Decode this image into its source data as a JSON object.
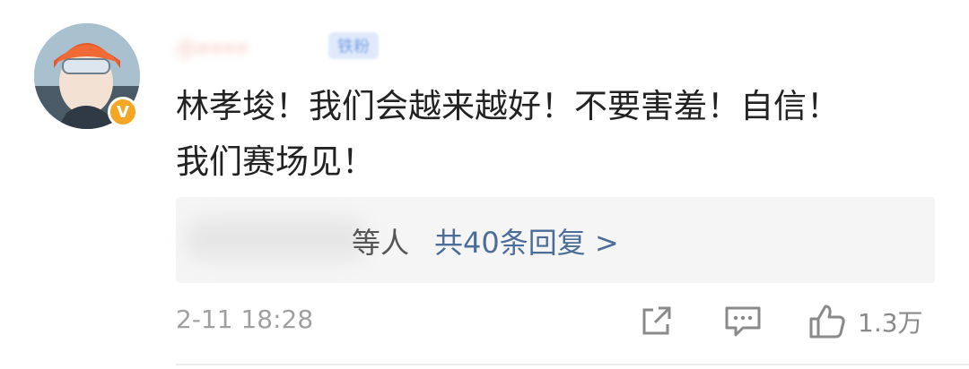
{
  "comment": {
    "author": {
      "name": "小••••",
      "fan_badge": "铁粉",
      "verified_badge": "V"
    },
    "text_line1": "林孝埈！我们会越来越好！不要害羞！自信！",
    "text_line2": "我们赛场见！",
    "replies": {
      "prefix": "等人",
      "link_text": "共40条回复 >"
    },
    "time": "2-11 18:28",
    "actions": {
      "likes": "1.3万"
    }
  },
  "colors": {
    "accent": "#4a6d9a",
    "badge": "#f5a623"
  },
  "icons": [
    "share-icon",
    "comment-icon",
    "like-icon"
  ]
}
